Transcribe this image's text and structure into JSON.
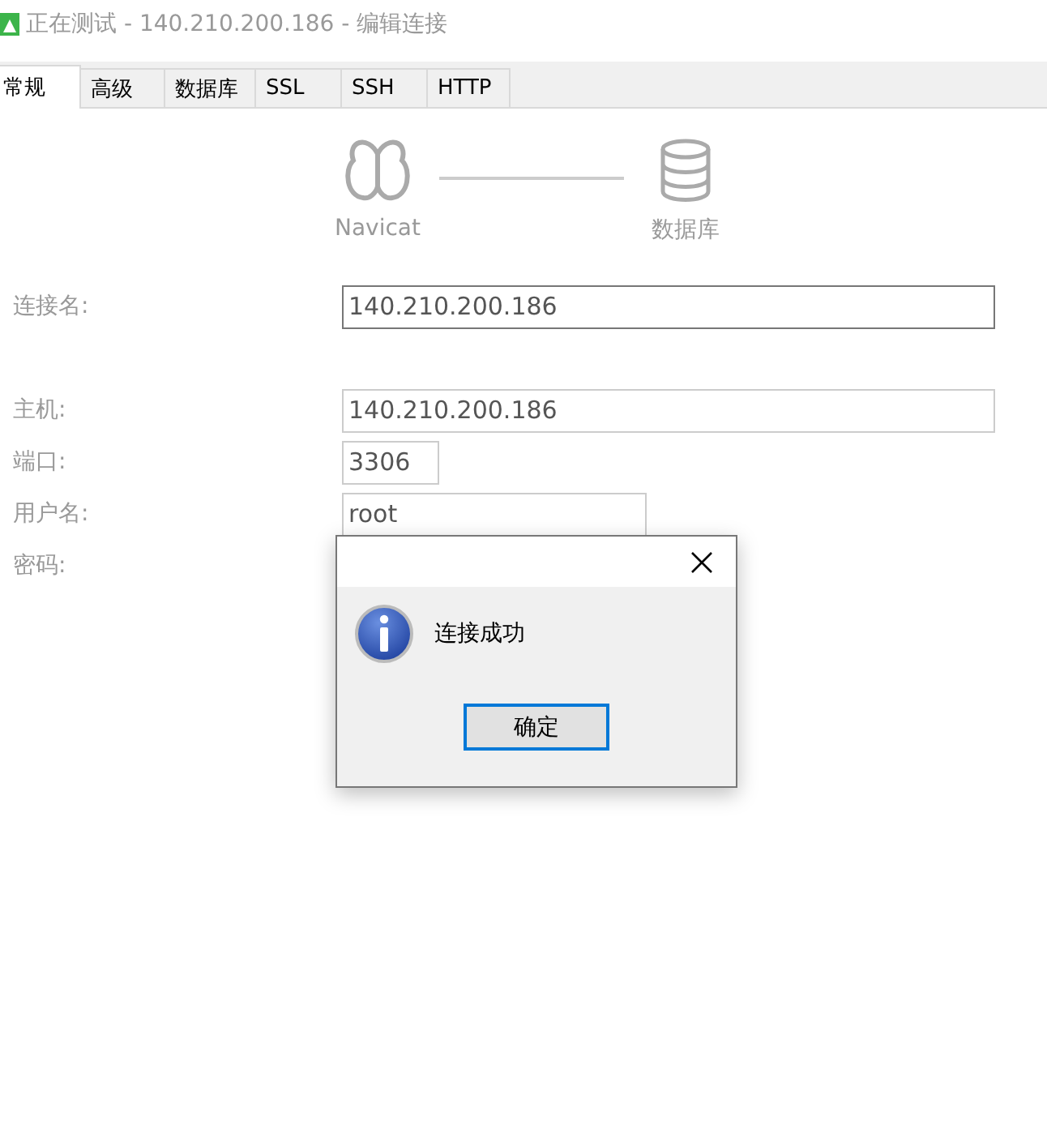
{
  "window": {
    "title": "正在测试 - 140.210.200.186 - 编辑连接"
  },
  "tabs": [
    {
      "label": "常规",
      "selected": true
    },
    {
      "label": "高级",
      "selected": false
    },
    {
      "label": "数据库",
      "selected": false
    },
    {
      "label": "SSL",
      "selected": false
    },
    {
      "label": "SSH",
      "selected": false
    },
    {
      "label": "HTTP",
      "selected": false
    }
  ],
  "diagram": {
    "source_label": "Navicat",
    "target_label": "数据库"
  },
  "connection_name": {
    "label": "连接名:",
    "value": "140.210.200.186",
    "focused": true
  },
  "fields": [
    {
      "label": "主机:",
      "value": "140.210.200.186",
      "focused": false
    },
    {
      "label": "端口:",
      "value": "3306",
      "focused": false
    },
    {
      "label": "用户名:",
      "value": "root",
      "focused": false
    },
    {
      "label": "密码:"
    }
  ],
  "dialog": {
    "message": "连接成功",
    "button": "确定"
  }
}
